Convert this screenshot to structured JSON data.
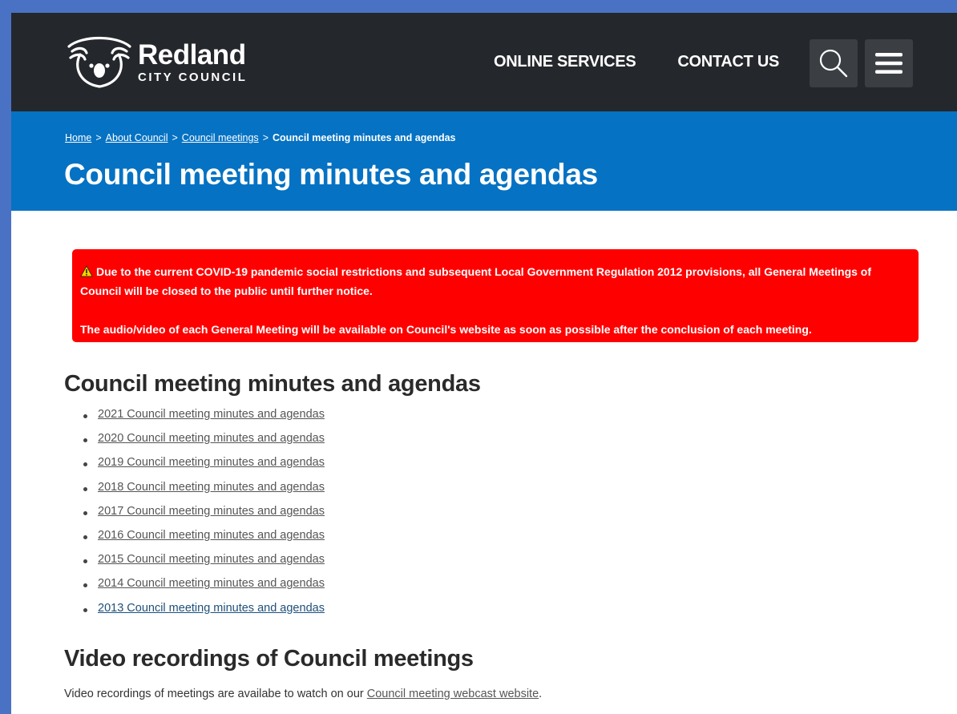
{
  "header": {
    "logo_name": "Redland",
    "logo_sub": "CITY COUNCIL",
    "nav": [
      "ONLINE SERVICES",
      "CONTACT US"
    ],
    "search_icon": "search-icon",
    "menu_icon": "hamburger-menu-icon"
  },
  "breadcrumb": {
    "items": [
      "Home",
      "About Council",
      "Council meetings"
    ],
    "separator": ">",
    "current": "Council meeting minutes and agendas"
  },
  "page_title": "Council meeting minutes and agendas",
  "alert": {
    "icon": "warning-icon",
    "line1": "Due to the current COVID-19 pandemic social restrictions and subsequent Local Government Regulation 2012 provisions, all General Meetings of Council will be closed to the public until further notice.",
    "line2": "The audio/video of each General Meeting will be available on Council's website as soon as possible after the conclusion of each meeting."
  },
  "minutes_section": {
    "heading": "Council meeting minutes and agendas",
    "links": [
      "2021 Council meeting minutes and agendas",
      "2020 Council meeting minutes and agendas",
      "2019 Council meeting minutes and agendas",
      "2018 Council meeting minutes and agendas",
      "2017 Council meeting minutes and agendas",
      "2016 Council meeting minutes and agendas",
      "2015 Council meeting minutes and agendas",
      "2014 Council meeting minutes and agendas",
      "2013 Council meeting minutes and agendas"
    ]
  },
  "video_section": {
    "heading": "Video recordings of Council meetings",
    "text_before": "Video recordings of meetings are availabe to watch on our ",
    "link": "Council meeting webcast website",
    "text_after": "."
  },
  "colors": {
    "header_bg": "#24272b",
    "banner_bg": "#0572c3",
    "alert_bg": "#ff0000",
    "visited_link": "#1e4f7a"
  }
}
